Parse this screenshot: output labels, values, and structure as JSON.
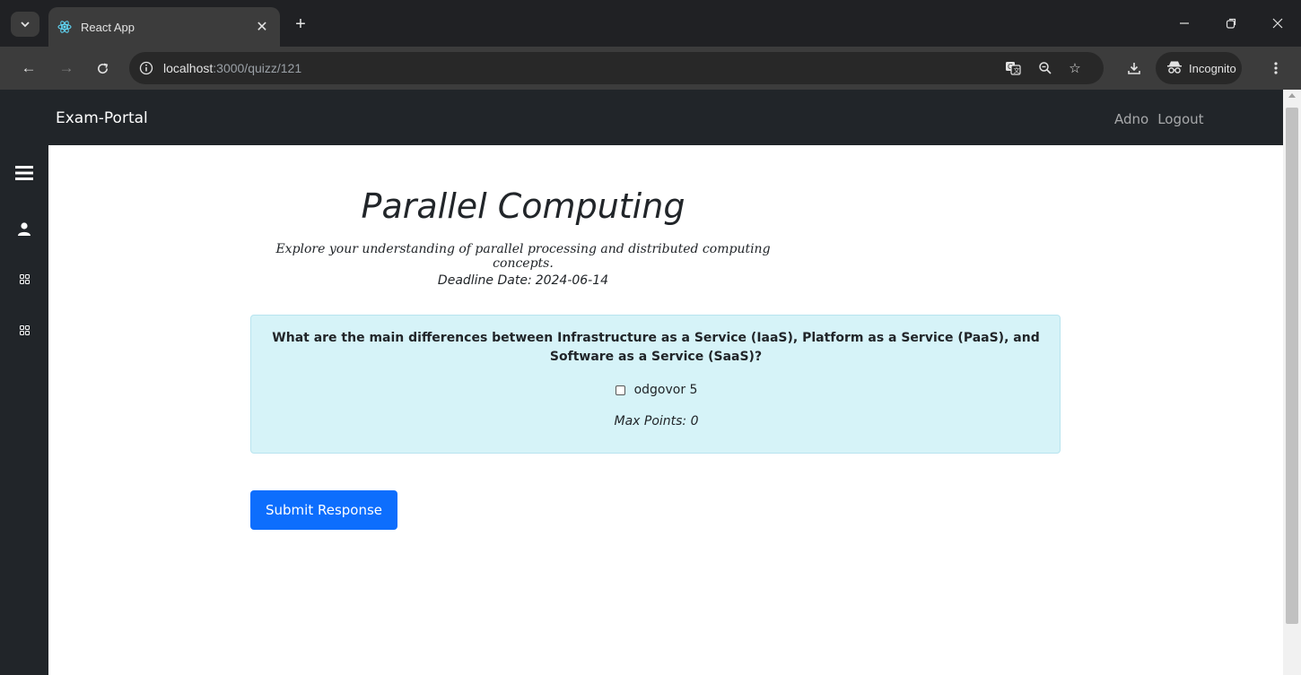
{
  "browser": {
    "tab_title": "React App",
    "url_host": "localhost",
    "url_path": ":3000/quizz/121",
    "incognito_label": "Incognito",
    "icons": [
      "tab-search-icon",
      "react-icon",
      "close-icon",
      "plus-icon",
      "minimize-icon",
      "restore-icon",
      "window-close-icon",
      "back-icon",
      "forward-icon",
      "reload-icon",
      "info-icon",
      "translate-icon",
      "zoom-icon",
      "star-icon",
      "download-icon",
      "incognito-icon",
      "more-icon"
    ]
  },
  "navbar": {
    "brand": "Exam-Portal",
    "user": "Adno",
    "logout": "Logout"
  },
  "sidebar": {
    "icons": [
      "hamburger-icon",
      "user-icon",
      "grid-icon",
      "grid-icon"
    ]
  },
  "quiz": {
    "title": "Parallel Computing",
    "description": "Explore your understanding of parallel processing and distributed computing concepts.",
    "deadline_label": "Deadline Date:",
    "deadline_value": "2024-06-14"
  },
  "question": {
    "text": "What are the main differences between Infrastructure as a Service (IaaS), Platform as a Service (PaaS), and Software as a Service (SaaS)?",
    "options": [
      {
        "label": "odgovor 5",
        "checked": false
      }
    ],
    "max_points_label": "Max Points: 0"
  },
  "submit_label": "Submit Response",
  "colors": {
    "navbar_bg": "#212529",
    "card_bg": "#d6f3f8",
    "button_bg": "#0d6efd"
  }
}
